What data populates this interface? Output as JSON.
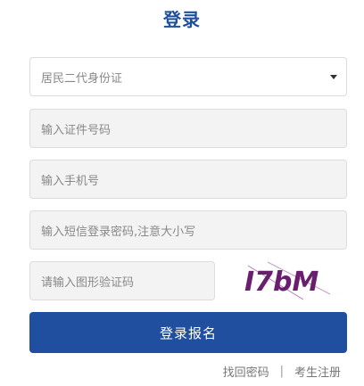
{
  "page": {
    "title": "登录"
  },
  "form": {
    "id_type_selected": "居民二代身份证",
    "id_number_placeholder": "输入证件号码",
    "phone_placeholder": "输入手机号",
    "sms_code_placeholder": "输入短信登录密码,注意大小写",
    "captcha_placeholder": "请输入图形验证码",
    "captcha_text": "I7bM",
    "submit_label": "登录报名"
  },
  "links": {
    "retrieve_password": "找回密码",
    "separator": "|",
    "register": "考生注册"
  }
}
